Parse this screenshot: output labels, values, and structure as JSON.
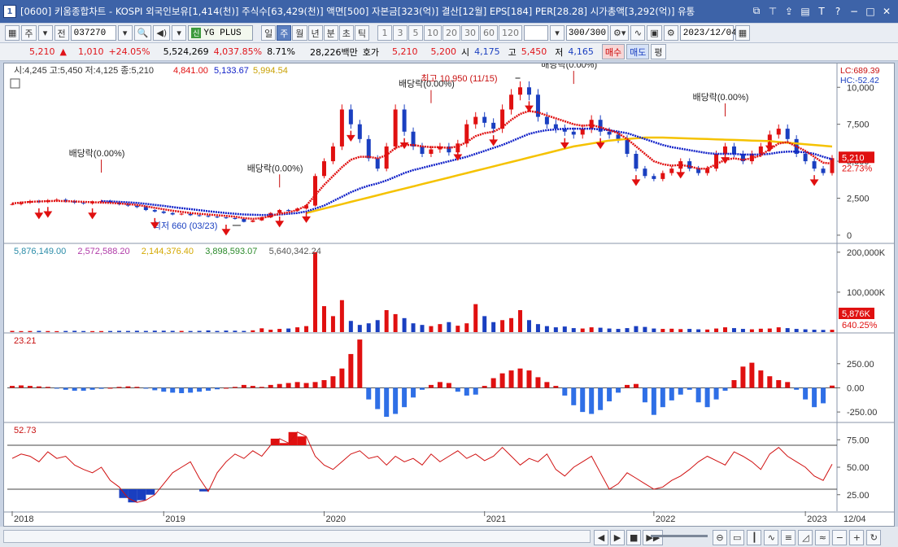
{
  "window": {
    "number": "1",
    "title": "[0600] 키움종합차트 - KOSPI 외국인보유[1,414(천)] 주식수[63,429(천)] 액면[500] 자본금[323(억)] 결산[12월] EPS[184] PER[28.28] 시가총액[3,292(억)] 유통"
  },
  "toolbar": {
    "market_select": "주",
    "period_select": "전",
    "code": "037270",
    "condition_label": "YG PLUS",
    "period_tabs": [
      "일",
      "주",
      "월",
      "년",
      "분",
      "초",
      "틱"
    ],
    "active_period": "주",
    "interval_buttons": [
      "1",
      "3",
      "5",
      "10",
      "20",
      "30",
      "60",
      "120"
    ],
    "count": "300/300",
    "date": "2023/12/04"
  },
  "quote": {
    "price": "5,210",
    "change": "1,010",
    "change_pct": "+24.05%",
    "volume": "5,524,269",
    "volume_pct": "4,037.85%",
    "turnover": "8.71%",
    "amount": "28,226백만",
    "hoga_label": "호가",
    "ask": "5,210",
    "bid": "5,200",
    "open_label": "시",
    "open": "4,175",
    "high_label": "고",
    "high": "5,450",
    "low_label": "저",
    "low": "4,165",
    "buy_label": "매수",
    "sell_label": "매도",
    "avg_label": "평"
  },
  "chart_data": [
    {
      "type": "line",
      "panel": "price",
      "legend": {
        "ohlc": "시:4,245 고:5,450 저:4,125 종:5,210",
        "ma1": "4,841.00",
        "ma2": "5,133.67",
        "ma3": "5,994.54"
      },
      "colors": {
        "ma1": "#e01010",
        "ma2": "#1020c8",
        "ma3": "#f5c200",
        "up": "#e01010",
        "down": "#1a3fc0"
      },
      "x_labels": [
        "2018",
        "2019",
        "2020",
        "2021",
        "2022",
        "2023",
        "12/04"
      ],
      "y_ticks": [
        "10,000",
        "7,500",
        "5,000",
        "2,500",
        "0"
      ],
      "ylim": [
        -500,
        11500
      ],
      "corner_labels": [
        "LC:689.39",
        "HC:-52.42"
      ],
      "price_badge": "5,210",
      "pct_badge": "22.73%",
      "annotations": {
        "high": "최고 10,950 (11/15)",
        "low": "최저 660 (03/23)",
        "dividend": "배당락(0.00%)"
      },
      "close_series": [
        2100,
        2200,
        2300,
        2250,
        2350,
        2400,
        2300,
        2200,
        2150,
        2250,
        2300,
        2200,
        2100,
        2000,
        1900,
        1700,
        1600,
        1500,
        1400,
        1450,
        1350,
        1300,
        1250,
        1200,
        1150,
        1100,
        900,
        1000,
        1200,
        1500,
        1700,
        1650,
        1800,
        2000,
        4000,
        5000,
        6000,
        8500,
        7500,
        6500,
        5200,
        4500,
        6000,
        8500,
        7000,
        6000,
        5500,
        5800,
        6000,
        5600,
        6200,
        7500,
        8000,
        7600,
        7200,
        8500,
        9500,
        10000,
        9500,
        8000,
        7500,
        7200,
        7000,
        6800,
        7200,
        7800,
        7000,
        6800,
        6500,
        5500,
        4500,
        4000,
        3800,
        4200,
        4500,
        5000,
        4500,
        4200,
        4500,
        5500,
        6000,
        5500,
        5000,
        5500,
        6000,
        6800,
        7200,
        6500,
        5500,
        5000,
        4500,
        4200,
        5210
      ],
      "ma1_series": [
        2150,
        2200,
        2250,
        2280,
        2300,
        2320,
        2300,
        2280,
        2250,
        2230,
        2200,
        2180,
        2150,
        2100,
        2050,
        1950,
        1850,
        1750,
        1650,
        1580,
        1500,
        1450,
        1400,
        1350,
        1300,
        1250,
        1150,
        1100,
        1150,
        1300,
        1450,
        1550,
        1700,
        2000,
        2700,
        3400,
        4000,
        4600,
        5100,
        5300,
        5300,
        5200,
        5400,
        5900,
        6100,
        6100,
        6000,
        5950,
        5950,
        5900,
        6000,
        6300,
        6700,
        6900,
        7000,
        7300,
        7800,
        8200,
        8400,
        8300,
        8100,
        7900,
        7700,
        7500,
        7400,
        7450,
        7300,
        7100,
        6900,
        6500,
        6000,
        5500,
        5000,
        4800,
        4700,
        4750,
        4650,
        4500,
        4500,
        4800,
        5100,
        5200,
        5100,
        5200,
        5400,
        5800,
        6200,
        6300,
        6000,
        5700,
        5300,
        4900,
        4841
      ],
      "ma2_series": [
        null,
        null,
        null,
        null,
        null,
        null,
        null,
        null,
        null,
        null,
        2300,
        2280,
        2250,
        2220,
        2180,
        2120,
        2050,
        1980,
        1900,
        1830,
        1760,
        1690,
        1620,
        1560,
        1500,
        1450,
        1400,
        1380,
        1360,
        1370,
        1400,
        1450,
        1500,
        1600,
        1800,
        2000,
        2300,
        2600,
        2900,
        3150,
        3350,
        3500,
        3700,
        3950,
        4200,
        4400,
        4550,
        4700,
        4850,
        5000,
        5150,
        5300,
        5500,
        5700,
        5900,
        6100,
        6350,
        6600,
        6850,
        7000,
        7100,
        7150,
        7200,
        7200,
        7200,
        7200,
        7150,
        7100,
        7000,
        6900,
        6700,
        6500,
        6300,
        6100,
        5950,
        5850,
        5750,
        5650,
        5550,
        5500,
        5500,
        5500,
        5450,
        5450,
        5450,
        5500,
        5600,
        5650,
        5650,
        5600,
        5500,
        5300,
        5134
      ],
      "ma3_series": [
        null,
        null,
        null,
        null,
        null,
        null,
        null,
        null,
        null,
        null,
        null,
        null,
        null,
        null,
        null,
        null,
        null,
        null,
        null,
        null,
        null,
        null,
        null,
        null,
        null,
        null,
        null,
        null,
        null,
        null,
        null,
        null,
        null,
        1500,
        1650,
        1800,
        1950,
        2100,
        2250,
        2400,
        2550,
        2700,
        2850,
        3000,
        3150,
        3300,
        3450,
        3600,
        3750,
        3900,
        4050,
        4200,
        4350,
        4500,
        4650,
        4800,
        4950,
        5100,
        5250,
        5400,
        5550,
        5700,
        5850,
        6000,
        6100,
        6200,
        6300,
        6400,
        6450,
        6500,
        6550,
        6600,
        6600,
        6600,
        6580,
        6560,
        6540,
        6520,
        6500,
        6480,
        6460,
        6440,
        6420,
        6400,
        6380,
        6360,
        6300,
        6250,
        6200,
        6150,
        6100,
        6050,
        5995
      ]
    },
    {
      "type": "bar",
      "panel": "volume",
      "legend": [
        "5,876,149.00",
        "2,572,588.20",
        "2,144,376.40",
        "3,898,593.07",
        "5,640,342.24"
      ],
      "legend_colors": [
        "#2a8ca8",
        "#b03aa8",
        "#d4a800",
        "#2a8a2a",
        "#555555"
      ],
      "y_ticks": [
        "200,000K",
        "100,000K"
      ],
      "ylim": [
        0,
        220000
      ],
      "badges": [
        "5,876K",
        "640.25%"
      ],
      "values": [
        3000,
        2500,
        2800,
        3100,
        2600,
        2400,
        2900,
        3300,
        2700,
        2500,
        2600,
        2800,
        3200,
        2900,
        3400,
        3000,
        3600,
        3500,
        3200,
        3000,
        2800,
        3100,
        4200,
        2900,
        3800,
        3500,
        3000,
        4500,
        9500,
        6000,
        8000,
        9000,
        12000,
        15000,
        200000,
        65000,
        40000,
        80000,
        28000,
        18000,
        22000,
        30000,
        55000,
        45000,
        35000,
        22000,
        18000,
        15000,
        20000,
        25000,
        16000,
        22000,
        70000,
        40000,
        25000,
        30000,
        35000,
        55000,
        30000,
        20000,
        15000,
        12000,
        14000,
        10000,
        9000,
        12000,
        11000,
        9000,
        8000,
        10000,
        15000,
        13000,
        9000,
        8000,
        8500,
        7500,
        8000,
        7000,
        6500,
        9000,
        12000,
        10000,
        8000,
        7000,
        8500,
        9000,
        12000,
        10000,
        8000,
        7000,
        6000,
        5500,
        5876
      ]
    },
    {
      "type": "bar",
      "panel": "oscillator",
      "legend": "23.21",
      "y_ticks": [
        "250.00",
        "0.00",
        "-250.00"
      ],
      "ylim": [
        -350,
        560
      ],
      "values": [
        20,
        25,
        20,
        15,
        10,
        -5,
        -20,
        -30,
        -30,
        -20,
        -10,
        0,
        10,
        15,
        10,
        -5,
        -25,
        -40,
        -50,
        -55,
        -50,
        -40,
        -30,
        -15,
        0,
        10,
        30,
        20,
        10,
        30,
        40,
        50,
        60,
        50,
        60,
        80,
        120,
        200,
        350,
        500,
        -120,
        -220,
        -300,
        -270,
        -200,
        -100,
        -20,
        30,
        60,
        50,
        -40,
        -80,
        -70,
        20,
        100,
        150,
        180,
        200,
        180,
        110,
        60,
        20,
        -80,
        -180,
        -250,
        -270,
        -230,
        -140,
        -50,
        30,
        40,
        -150,
        -280,
        -200,
        -130,
        -70,
        -20,
        -150,
        -200,
        -120,
        -30,
        80,
        220,
        260,
        180,
        120,
        80,
        60,
        -20,
        -120,
        -200,
        -160,
        23
      ]
    },
    {
      "type": "line",
      "panel": "rsi",
      "legend": "52.73",
      "y_ticks": [
        "75.00",
        "50.00",
        "25.00"
      ],
      "ylim": [
        10,
        90
      ],
      "upper_band": 70,
      "lower_band": 30,
      "values": [
        58,
        62,
        60,
        55,
        64,
        58,
        60,
        52,
        48,
        45,
        50,
        38,
        32,
        22,
        18,
        20,
        25,
        35,
        45,
        50,
        55,
        40,
        28,
        45,
        55,
        62,
        58,
        65,
        60,
        70,
        76,
        72,
        82,
        78,
        60,
        52,
        48,
        55,
        62,
        65,
        58,
        60,
        52,
        60,
        55,
        58,
        52,
        62,
        55,
        60,
        65,
        58,
        62,
        56,
        60,
        68,
        60,
        52,
        58,
        55,
        62,
        48,
        42,
        50,
        55,
        60,
        45,
        30,
        35,
        45,
        40,
        35,
        30,
        32,
        38,
        42,
        48,
        55,
        60,
        56,
        52,
        64,
        60,
        55,
        48,
        62,
        68,
        60,
        55,
        50,
        42,
        38,
        52.73
      ]
    }
  ],
  "bottom": {
    "nav_buttons": [
      "◀",
      "▶",
      "■",
      "▶▶"
    ]
  }
}
